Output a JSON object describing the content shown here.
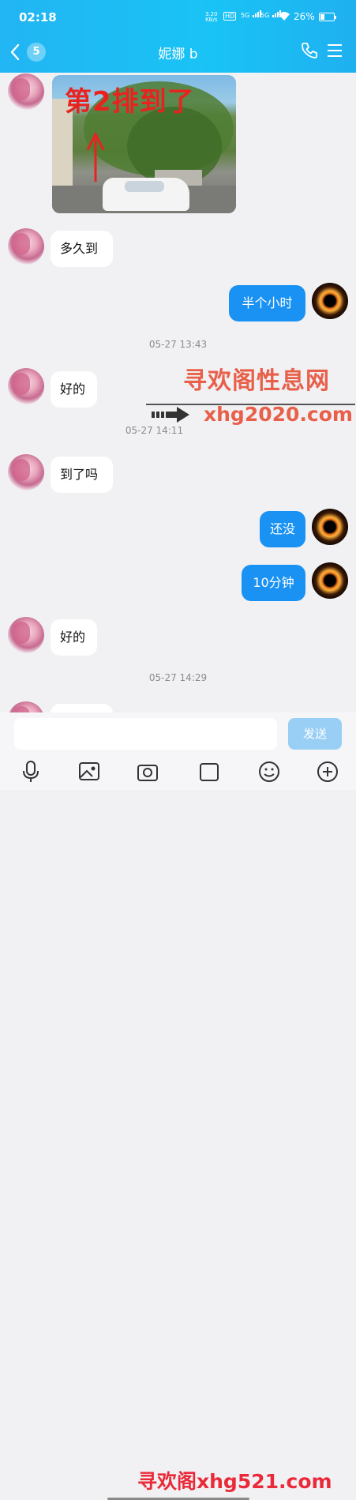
{
  "status_bar": {
    "time": "02:18",
    "speed_value": "3.20",
    "speed_unit": "KB/s",
    "hd_label": "HD",
    "sig1": "5G",
    "sig2": "5G",
    "battery": "26%"
  },
  "header": {
    "unread_count": "5",
    "title": "妮娜  b"
  },
  "photo_message": {
    "caption": "第2排到了"
  },
  "messages": [
    {
      "side": "left",
      "text": "多久到"
    },
    {
      "side": "right",
      "text": "半个小时"
    },
    {
      "type": "time",
      "text": "05-27 13:43"
    },
    {
      "side": "left",
      "text": "好的"
    },
    {
      "type": "time",
      "text": "05-27 14:11"
    },
    {
      "side": "left",
      "text": "到了吗"
    },
    {
      "side": "right",
      "text": "还没"
    },
    {
      "side": "right",
      "text": "10分钟"
    },
    {
      "side": "left",
      "text": "好的"
    },
    {
      "type": "time",
      "text": "05-27 14:29"
    }
  ],
  "watermarks": {
    "top_text": "寻欢阁性息网",
    "top_url": "xhg2020.com",
    "bottom_text": "寻欢阁xhg521.com"
  },
  "composer": {
    "send_label": "发送"
  },
  "colors": {
    "header_bg": "#19c3f5",
    "bubble_right": "#1a92f3",
    "send_disabled": "#99cff5",
    "watermark": "#e8604a"
  },
  "icons": [
    "chevron-left-icon",
    "phone-icon",
    "menu-icon",
    "mic-icon",
    "image-icon",
    "camera-icon",
    "emoji-icon",
    "plus-icon"
  ]
}
